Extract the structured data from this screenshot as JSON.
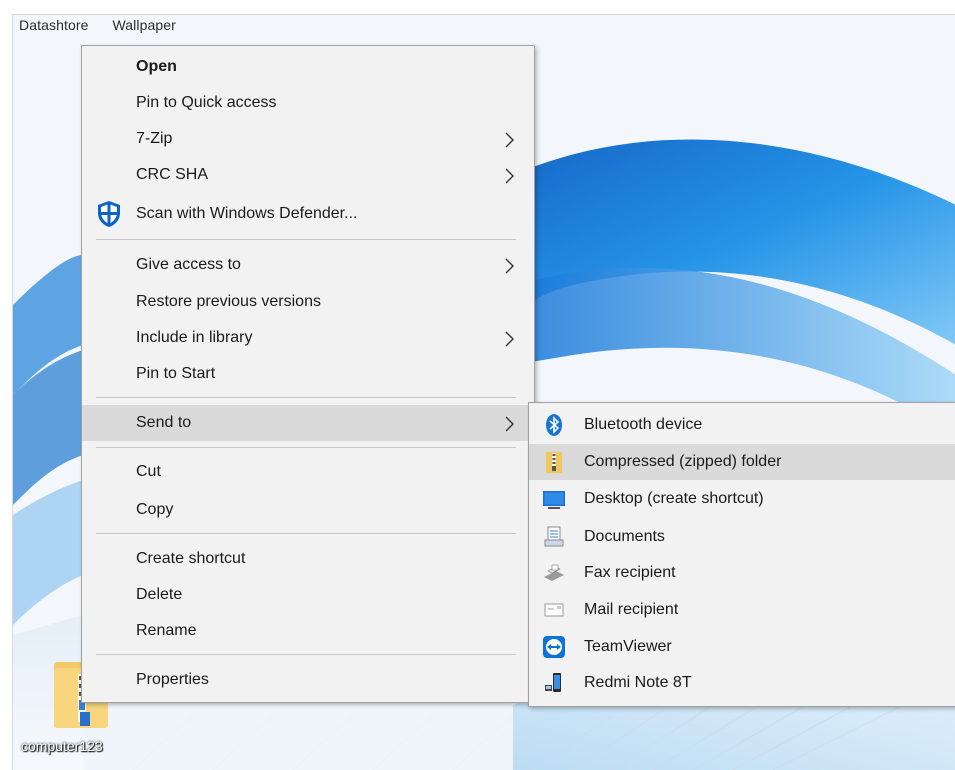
{
  "desktop": {
    "top_text_1": "Datashtore",
    "top_text_2": "Wallpaper",
    "file_label": "computer123"
  },
  "context_menu": {
    "items": [
      {
        "label": "Open"
      },
      {
        "label": "Pin to Quick access"
      },
      {
        "label": "7-Zip",
        "has_submenu": true
      },
      {
        "label": "CRC SHA",
        "has_submenu": true
      },
      {
        "label": "Scan with Windows Defender..."
      },
      {
        "label": "Give access to",
        "has_submenu": true
      },
      {
        "label": "Restore previous versions"
      },
      {
        "label": "Include in library",
        "has_submenu": true
      },
      {
        "label": "Pin to Start"
      },
      {
        "label": "Send to",
        "has_submenu": true,
        "hovered": true
      },
      {
        "label": "Cut"
      },
      {
        "label": "Copy"
      },
      {
        "label": "Create shortcut"
      },
      {
        "label": "Delete"
      },
      {
        "label": "Rename"
      },
      {
        "label": "Properties"
      }
    ]
  },
  "send_to_menu": {
    "items": [
      {
        "label": "Bluetooth device",
        "icon": "bluetooth-icon"
      },
      {
        "label": "Compressed (zipped) folder",
        "icon": "zip-folder-icon",
        "hovered": true
      },
      {
        "label": "Desktop (create shortcut)",
        "icon": "desktop-icon"
      },
      {
        "label": "Documents",
        "icon": "documents-icon"
      },
      {
        "label": "Fax recipient",
        "icon": "fax-icon"
      },
      {
        "label": "Mail recipient",
        "icon": "mail-icon"
      },
      {
        "label": "TeamViewer",
        "icon": "teamviewer-icon"
      },
      {
        "label": "Redmi Note 8T",
        "icon": "phone-icon"
      }
    ]
  },
  "colors": {
    "menu_bg": "#f2f2f2",
    "hover_bg": "#dadada",
    "accent_blue": "#0078d7"
  }
}
